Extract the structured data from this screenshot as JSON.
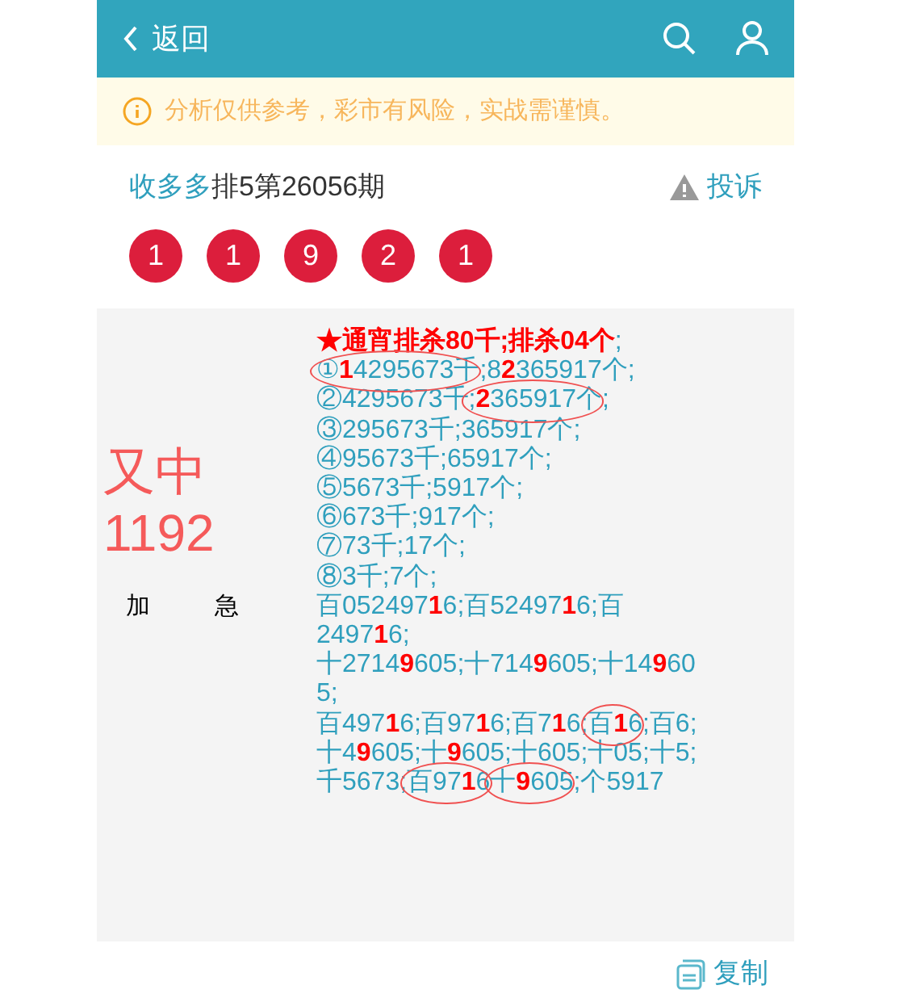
{
  "header": {
    "back_label": "返回"
  },
  "notice": "分析仅供参考，彩市有风险，实战需谨慎。",
  "title": {
    "author": "收多多",
    "issue": "排5第26056期",
    "report_label": "投诉"
  },
  "balls": [
    "1",
    "1",
    "9",
    "2",
    "1"
  ],
  "result": {
    "status": "又中",
    "score": "1192",
    "tags": [
      "加",
      "急"
    ]
  },
  "lines": [
    [
      {
        "kind": "title",
        "text": "★通宵排杀80千;排杀04个"
      },
      {
        "kind": "plain",
        "text": ";"
      }
    ],
    [
      {
        "kind": "circle",
        "segments": [
          {
            "kind": "plain",
            "text": "①"
          },
          {
            "kind": "red",
            "text": "1"
          },
          {
            "kind": "plain",
            "text": "4295673千"
          }
        ]
      },
      {
        "kind": "plain",
        "text": ";8"
      },
      {
        "kind": "red",
        "text": "2"
      },
      {
        "kind": "plain",
        "text": "365917个;"
      }
    ],
    [
      {
        "kind": "plain",
        "text": "②4295673千"
      },
      {
        "kind": "circle",
        "segments": [
          {
            "kind": "plain",
            "text": ";"
          },
          {
            "kind": "red",
            "text": "2"
          },
          {
            "kind": "plain",
            "text": "365917个"
          }
        ]
      },
      {
        "kind": "plain",
        "text": ";"
      }
    ],
    [
      {
        "kind": "plain",
        "text": "③295673千;365917个;"
      }
    ],
    [
      {
        "kind": "plain",
        "text": "④95673千;65917个;"
      }
    ],
    [
      {
        "kind": "plain",
        "text": "⑤5673千;5917个;"
      }
    ],
    [
      {
        "kind": "plain",
        "text": "⑥673千;917个;"
      }
    ],
    [
      {
        "kind": "plain",
        "text": "⑦73千;17个;"
      }
    ],
    [
      {
        "kind": "plain",
        "text": "⑧3千;7个;"
      }
    ],
    [
      {
        "kind": "plain",
        "text": "百052497"
      },
      {
        "kind": "red",
        "text": "1"
      },
      {
        "kind": "plain",
        "text": "6;百52497"
      },
      {
        "kind": "red",
        "text": "1"
      },
      {
        "kind": "plain",
        "text": "6;百"
      }
    ],
    [
      {
        "kind": "plain",
        "text": "2497"
      },
      {
        "kind": "red",
        "text": "1"
      },
      {
        "kind": "plain",
        "text": "6;"
      }
    ],
    [
      {
        "kind": "plain",
        "text": "十2714"
      },
      {
        "kind": "red",
        "text": "9"
      },
      {
        "kind": "plain",
        "text": "605;十714"
      },
      {
        "kind": "red",
        "text": "9"
      },
      {
        "kind": "plain",
        "text": "605;十14"
      },
      {
        "kind": "red",
        "text": "9"
      },
      {
        "kind": "plain",
        "text": "60"
      }
    ],
    [
      {
        "kind": "plain",
        "text": "5;"
      }
    ],
    [
      {
        "kind": "plain",
        "text": "百497"
      },
      {
        "kind": "red",
        "text": "1"
      },
      {
        "kind": "plain",
        "text": "6;百97"
      },
      {
        "kind": "red",
        "text": "1"
      },
      {
        "kind": "plain",
        "text": "6;百7"
      },
      {
        "kind": "red",
        "text": "1"
      },
      {
        "kind": "plain",
        "text": "6;"
      },
      {
        "kind": "circle",
        "segments": [
          {
            "kind": "plain",
            "text": "百"
          },
          {
            "kind": "red",
            "text": "1"
          },
          {
            "kind": "plain",
            "text": "6"
          }
        ]
      },
      {
        "kind": "plain",
        "text": ";百6;"
      }
    ],
    [
      {
        "kind": "plain",
        "text": "十4"
      },
      {
        "kind": "red",
        "text": "9"
      },
      {
        "kind": "plain",
        "text": "605;十"
      },
      {
        "kind": "red",
        "text": "9"
      },
      {
        "kind": "plain",
        "text": "605;十605;十05;十5;"
      }
    ],
    [
      {
        "kind": "plain",
        "text": "千5673;"
      },
      {
        "kind": "circle",
        "segments": [
          {
            "kind": "plain",
            "text": "百97"
          },
          {
            "kind": "red",
            "text": "1"
          },
          {
            "kind": "plain",
            "text": "6"
          }
        ]
      },
      {
        "kind": "circle",
        "segments": [
          {
            "kind": "plain",
            "text": "十"
          },
          {
            "kind": "red",
            "text": "9"
          },
          {
            "kind": "plain",
            "text": "605"
          }
        ]
      },
      {
        "kind": "plain",
        "text": ";个5917"
      }
    ]
  ],
  "copy_label": "复制"
}
